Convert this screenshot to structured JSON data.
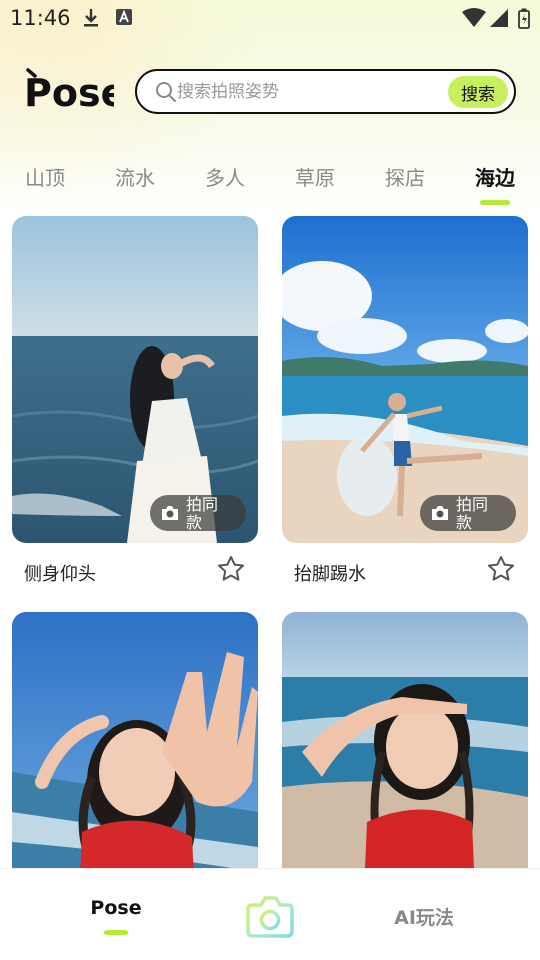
{
  "status_bar": {
    "time": "11:46",
    "icons": [
      "download-icon",
      "a-notification-icon",
      "wifi-icon",
      "signal-icon",
      "battery-icon"
    ]
  },
  "header": {
    "logo_text": "Pose",
    "search": {
      "placeholder": "搜索拍照姿势",
      "value": "",
      "button_label": "搜索"
    }
  },
  "tabs": {
    "items": [
      "山顶",
      "流水",
      "多人",
      "草原",
      "探店",
      "海边"
    ],
    "active": "海边"
  },
  "cards": [
    {
      "title": "侧身仰头",
      "action_label": "拍同款",
      "favorited": false
    },
    {
      "title": "抬脚踢水",
      "action_label": "拍同款",
      "favorited": false
    },
    {
      "title": "",
      "action_label": "",
      "favorited": false
    },
    {
      "title": "",
      "action_label": "",
      "favorited": false
    }
  ],
  "bottom_nav": {
    "items": [
      {
        "label": "Pose",
        "active": true
      },
      {
        "label": "",
        "icon": "camera-icon"
      },
      {
        "label": "AI玩法",
        "active": false
      }
    ]
  },
  "colors": {
    "accent": "#c8ef5e",
    "indicator": "#b7ea3c",
    "text_primary": "#111111",
    "text_inactive": "#8a8a8a"
  }
}
